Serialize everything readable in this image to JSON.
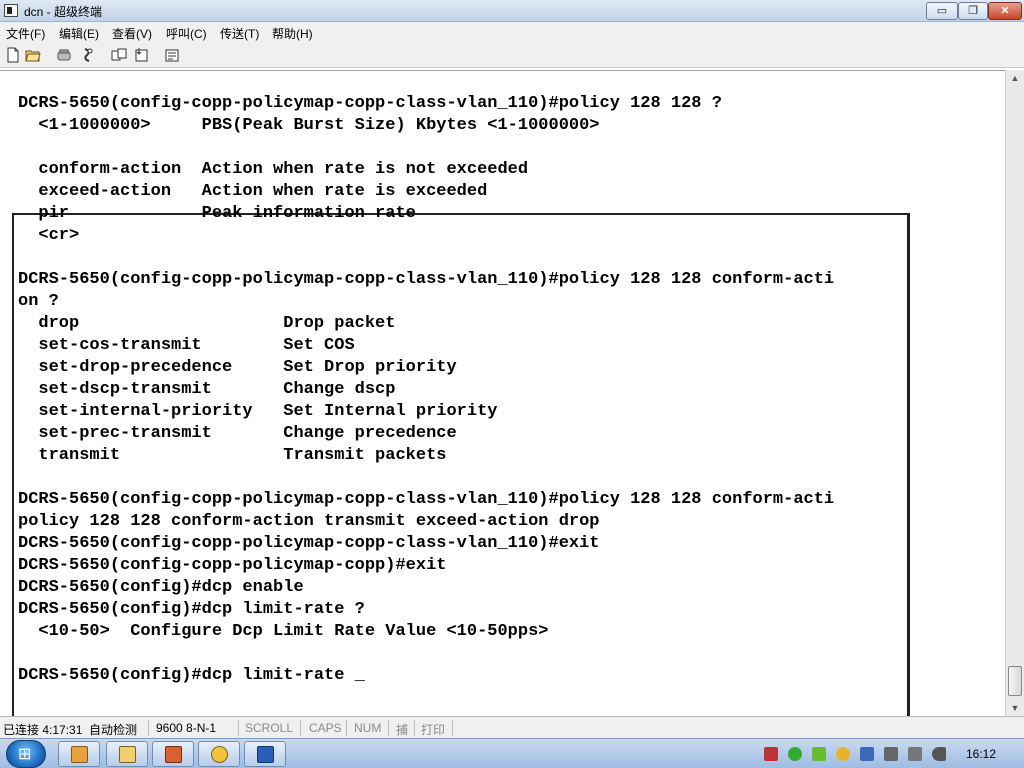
{
  "window": {
    "title": "dcn - 超级终端"
  },
  "window_buttons": {
    "minimize": "▭",
    "maximize": "❐",
    "close": "✕"
  },
  "menu": [
    "文件(F)",
    "编辑(E)",
    "查看(V)",
    "呼叫(C)",
    "传送(T)",
    "帮助(H)"
  ],
  "toolbar_icons": [
    "new-file-icon",
    "open-folder-icon",
    "phone-call-icon",
    "disconnect-icon",
    "send-file-icon",
    "receive-file-icon",
    "properties-icon"
  ],
  "terminal": {
    "lines": [
      "DCRS-5650(config-copp-policymap-copp-class-vlan_110)#policy 128 128 ?",
      "  <1-1000000>     PBS(Peak Burst Size) Kbytes <1-1000000>",
      "",
      "  conform-action  Action when rate is not exceeded",
      "  exceed-action   Action when rate is exceeded",
      "  pir             Peak information rate",
      "  <cr>",
      "",
      "DCRS-5650(config-copp-policymap-copp-class-vlan_110)#policy 128 128 conform-acti",
      "on ?",
      "  drop                    Drop packet",
      "  set-cos-transmit        Set COS",
      "  set-drop-precedence     Set Drop priority",
      "  set-dscp-transmit       Change dscp",
      "  set-internal-priority   Set Internal priority",
      "  set-prec-transmit       Change precedence",
      "  transmit                Transmit packets",
      "",
      "DCRS-5650(config-copp-policymap-copp-class-vlan_110)#policy 128 128 conform-acti",
      "policy 128 128 conform-action transmit exceed-action drop",
      "DCRS-5650(config-copp-policymap-copp-class-vlan_110)#exit",
      "DCRS-5650(config-copp-policymap-copp)#exit",
      "DCRS-5650(config)#dcp enable",
      "DCRS-5650(config)#dcp limit-rate ?",
      "  <10-50>  Configure Dcp Limit Rate Value <10-50pps>",
      "",
      "DCRS-5650(config)#dcp limit-rate _"
    ]
  },
  "status": {
    "connection": "已连接 4:17:31",
    "detect": "自动检测",
    "baud": "9600 8-N-1",
    "scroll": "SCROLL",
    "caps": "CAPS",
    "num": "NUM",
    "capture": "捕",
    "print": "打印"
  },
  "taskbar": {
    "apps": [
      "explorer-icon",
      "folder-icon",
      "presentation-icon",
      "paint-icon",
      "word-icon"
    ],
    "clock": "16:12"
  },
  "colors": {
    "terminal_bg": "#ffffff",
    "text": "#000000",
    "taskbar": "#b7cde8"
  }
}
